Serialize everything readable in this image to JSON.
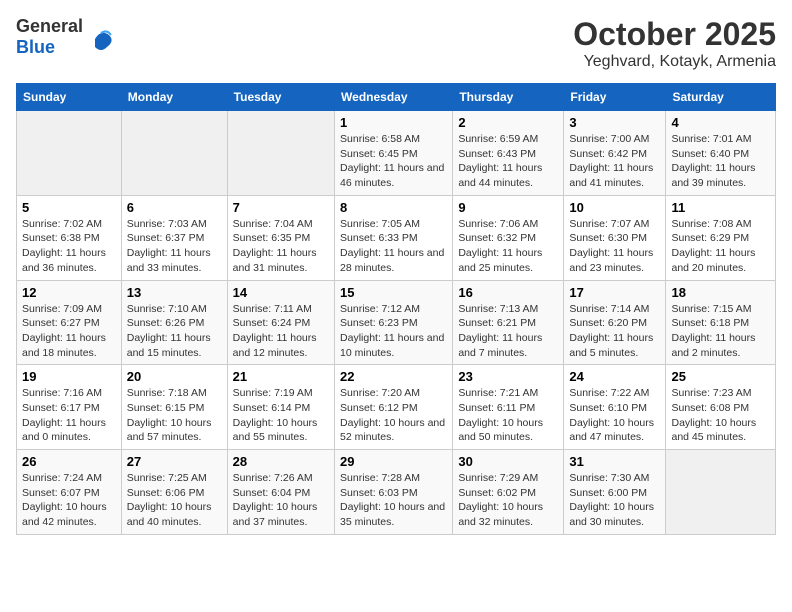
{
  "header": {
    "logo_general": "General",
    "logo_blue": "Blue",
    "title": "October 2025",
    "subtitle": "Yeghvard, Kotayk, Armenia"
  },
  "days_of_week": [
    "Sunday",
    "Monday",
    "Tuesday",
    "Wednesday",
    "Thursday",
    "Friday",
    "Saturday"
  ],
  "weeks": [
    [
      {
        "day": "",
        "info": ""
      },
      {
        "day": "",
        "info": ""
      },
      {
        "day": "",
        "info": ""
      },
      {
        "day": "1",
        "info": "Sunrise: 6:58 AM\nSunset: 6:45 PM\nDaylight: 11 hours and 46 minutes."
      },
      {
        "day": "2",
        "info": "Sunrise: 6:59 AM\nSunset: 6:43 PM\nDaylight: 11 hours and 44 minutes."
      },
      {
        "day": "3",
        "info": "Sunrise: 7:00 AM\nSunset: 6:42 PM\nDaylight: 11 hours and 41 minutes."
      },
      {
        "day": "4",
        "info": "Sunrise: 7:01 AM\nSunset: 6:40 PM\nDaylight: 11 hours and 39 minutes."
      }
    ],
    [
      {
        "day": "5",
        "info": "Sunrise: 7:02 AM\nSunset: 6:38 PM\nDaylight: 11 hours and 36 minutes."
      },
      {
        "day": "6",
        "info": "Sunrise: 7:03 AM\nSunset: 6:37 PM\nDaylight: 11 hours and 33 minutes."
      },
      {
        "day": "7",
        "info": "Sunrise: 7:04 AM\nSunset: 6:35 PM\nDaylight: 11 hours and 31 minutes."
      },
      {
        "day": "8",
        "info": "Sunrise: 7:05 AM\nSunset: 6:33 PM\nDaylight: 11 hours and 28 minutes."
      },
      {
        "day": "9",
        "info": "Sunrise: 7:06 AM\nSunset: 6:32 PM\nDaylight: 11 hours and 25 minutes."
      },
      {
        "day": "10",
        "info": "Sunrise: 7:07 AM\nSunset: 6:30 PM\nDaylight: 11 hours and 23 minutes."
      },
      {
        "day": "11",
        "info": "Sunrise: 7:08 AM\nSunset: 6:29 PM\nDaylight: 11 hours and 20 minutes."
      }
    ],
    [
      {
        "day": "12",
        "info": "Sunrise: 7:09 AM\nSunset: 6:27 PM\nDaylight: 11 hours and 18 minutes."
      },
      {
        "day": "13",
        "info": "Sunrise: 7:10 AM\nSunset: 6:26 PM\nDaylight: 11 hours and 15 minutes."
      },
      {
        "day": "14",
        "info": "Sunrise: 7:11 AM\nSunset: 6:24 PM\nDaylight: 11 hours and 12 minutes."
      },
      {
        "day": "15",
        "info": "Sunrise: 7:12 AM\nSunset: 6:23 PM\nDaylight: 11 hours and 10 minutes."
      },
      {
        "day": "16",
        "info": "Sunrise: 7:13 AM\nSunset: 6:21 PM\nDaylight: 11 hours and 7 minutes."
      },
      {
        "day": "17",
        "info": "Sunrise: 7:14 AM\nSunset: 6:20 PM\nDaylight: 11 hours and 5 minutes."
      },
      {
        "day": "18",
        "info": "Sunrise: 7:15 AM\nSunset: 6:18 PM\nDaylight: 11 hours and 2 minutes."
      }
    ],
    [
      {
        "day": "19",
        "info": "Sunrise: 7:16 AM\nSunset: 6:17 PM\nDaylight: 11 hours and 0 minutes."
      },
      {
        "day": "20",
        "info": "Sunrise: 7:18 AM\nSunset: 6:15 PM\nDaylight: 10 hours and 57 minutes."
      },
      {
        "day": "21",
        "info": "Sunrise: 7:19 AM\nSunset: 6:14 PM\nDaylight: 10 hours and 55 minutes."
      },
      {
        "day": "22",
        "info": "Sunrise: 7:20 AM\nSunset: 6:12 PM\nDaylight: 10 hours and 52 minutes."
      },
      {
        "day": "23",
        "info": "Sunrise: 7:21 AM\nSunset: 6:11 PM\nDaylight: 10 hours and 50 minutes."
      },
      {
        "day": "24",
        "info": "Sunrise: 7:22 AM\nSunset: 6:10 PM\nDaylight: 10 hours and 47 minutes."
      },
      {
        "day": "25",
        "info": "Sunrise: 7:23 AM\nSunset: 6:08 PM\nDaylight: 10 hours and 45 minutes."
      }
    ],
    [
      {
        "day": "26",
        "info": "Sunrise: 7:24 AM\nSunset: 6:07 PM\nDaylight: 10 hours and 42 minutes."
      },
      {
        "day": "27",
        "info": "Sunrise: 7:25 AM\nSunset: 6:06 PM\nDaylight: 10 hours and 40 minutes."
      },
      {
        "day": "28",
        "info": "Sunrise: 7:26 AM\nSunset: 6:04 PM\nDaylight: 10 hours and 37 minutes."
      },
      {
        "day": "29",
        "info": "Sunrise: 7:28 AM\nSunset: 6:03 PM\nDaylight: 10 hours and 35 minutes."
      },
      {
        "day": "30",
        "info": "Sunrise: 7:29 AM\nSunset: 6:02 PM\nDaylight: 10 hours and 32 minutes."
      },
      {
        "day": "31",
        "info": "Sunrise: 7:30 AM\nSunset: 6:00 PM\nDaylight: 10 hours and 30 minutes."
      },
      {
        "day": "",
        "info": ""
      }
    ]
  ]
}
